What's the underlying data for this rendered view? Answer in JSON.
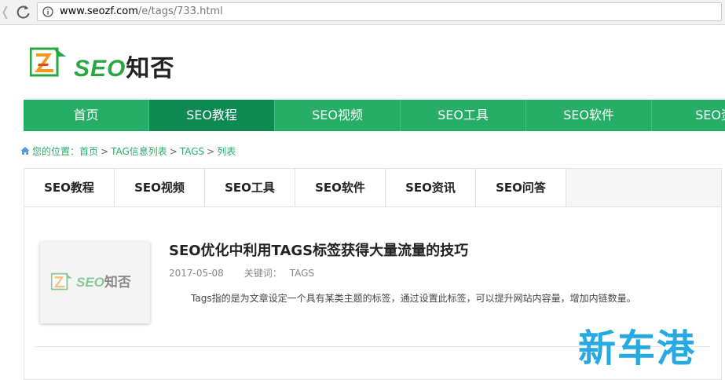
{
  "browser": {
    "url_host": "www.seozf.com",
    "url_path": "/e/tags/733.html"
  },
  "logo": {
    "brand_seo": "SEO",
    "brand_cn": "知否",
    "color_green": "#2aa644"
  },
  "nav": {
    "items": [
      {
        "label": "首页"
      },
      {
        "label": "SEO教程"
      },
      {
        "label": "SEO视频"
      },
      {
        "label": "SEO工具"
      },
      {
        "label": "SEO软件"
      },
      {
        "label": "SEO资"
      }
    ],
    "active_index": 1,
    "bg_color": "#27ae66",
    "active_color": "#0d8a52"
  },
  "breadcrumb": {
    "prefix": "您的位置：",
    "items": [
      "首页",
      "TAG信息列表",
      "TAGS",
      "列表"
    ],
    "separator": ">"
  },
  "tabs": [
    {
      "label": "SEO教程"
    },
    {
      "label": "SEO视频"
    },
    {
      "label": "SEO工具"
    },
    {
      "label": "SEO软件"
    },
    {
      "label": "SEO资讯"
    },
    {
      "label": "SEO问答"
    }
  ],
  "article": {
    "title": "SEO优化中利用TAGS标签获得大量流量的技巧",
    "date": "2017-05-08",
    "keywords_label": "关键词：",
    "keyword": "TAGS",
    "summary": "Tags指的是为文章设定一个具有某类主题的标签，通过设置此标签，可以提升网站内容量，增加内链数量。",
    "thumb_brand_seo": "SEO",
    "thumb_brand_cn": "知否"
  },
  "watermark": {
    "text": "新车港"
  }
}
